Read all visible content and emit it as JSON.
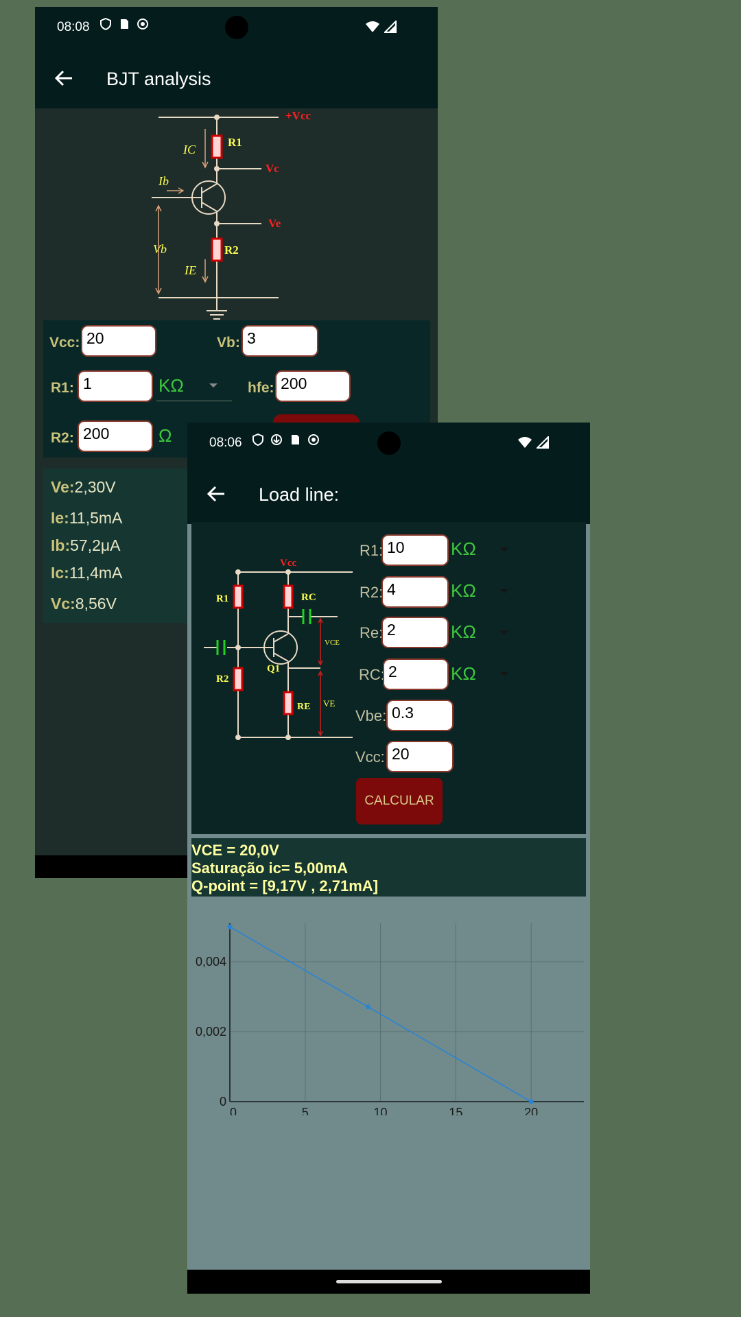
{
  "bjt": {
    "status_time": "08:08",
    "title": "BJT analysis",
    "diagram": {
      "vcc": "+Vcc",
      "r1": "R1",
      "vc": "Vc",
      "ve": "Ve",
      "r2": "R2",
      "ic": "IC",
      "ib": "Ib",
      "vb": "Vb",
      "ie": "IE"
    },
    "fields": {
      "vcc_label": "Vcc:",
      "vcc_value": "20",
      "vb_label": "Vb:",
      "vb_value": "3",
      "r1_label": "R1:",
      "r1_value": "1",
      "r1_unit": "KΩ",
      "hfe_label": "hfe:",
      "hfe_value": "200",
      "r2_label": "R2:",
      "r2_value": "200",
      "r2_unit": "Ω"
    },
    "results": [
      {
        "key": "Ve:",
        "value": "2,30V"
      },
      {
        "key": "Ie:",
        "value": "11,5mA"
      },
      {
        "key": "Ib:",
        "value": "57,2μA"
      },
      {
        "key": "Ic:",
        "value": "11,4mA"
      },
      {
        "key": "Vc:",
        "value": "8,56V"
      }
    ]
  },
  "load": {
    "status_time": "08:06",
    "title": "Load line:",
    "diagram": {
      "vcc": "Vcc",
      "r1": "R1",
      "rc": "RC",
      "vce": "VCE",
      "q1": "Q1",
      "r2": "R2",
      "re": "RE",
      "ve": "VE"
    },
    "fields": [
      {
        "label": "R1:",
        "value": "10",
        "unit": "KΩ"
      },
      {
        "label": "R2:",
        "value": "4",
        "unit": "KΩ"
      },
      {
        "label": "Re:",
        "value": "2",
        "unit": "KΩ"
      },
      {
        "label": "RC:",
        "value": "2",
        "unit": "KΩ"
      },
      {
        "label": "Vbe:",
        "value": "0.3"
      },
      {
        "label": "Vcc:",
        "value": "20"
      }
    ],
    "calc_button": "CALCULAR",
    "summary": {
      "line1": "VCE = 20,0V",
      "line2": " Saturação ic= 5,00mA",
      "line3": " Q-point = [9,17V , 2,71mA]"
    }
  },
  "colors": {
    "background": "#566e53",
    "appbar": "#041c1c",
    "accent_green": "#3ec83e",
    "button": "#7d0a0a",
    "chart_line": "#2a84d4"
  },
  "chart_data": {
    "type": "line",
    "x_ticks": [
      "0",
      "5",
      "10",
      "15",
      "20"
    ],
    "y_ticks": [
      "0",
      "0,002",
      "0,004"
    ],
    "xlim": [
      0,
      23.5
    ],
    "ylim": [
      0,
      0.0051
    ],
    "series": [
      {
        "x": [
          0,
          9.17,
          20
        ],
        "y": [
          0.005,
          0.00271,
          0
        ]
      }
    ],
    "grid": true
  }
}
